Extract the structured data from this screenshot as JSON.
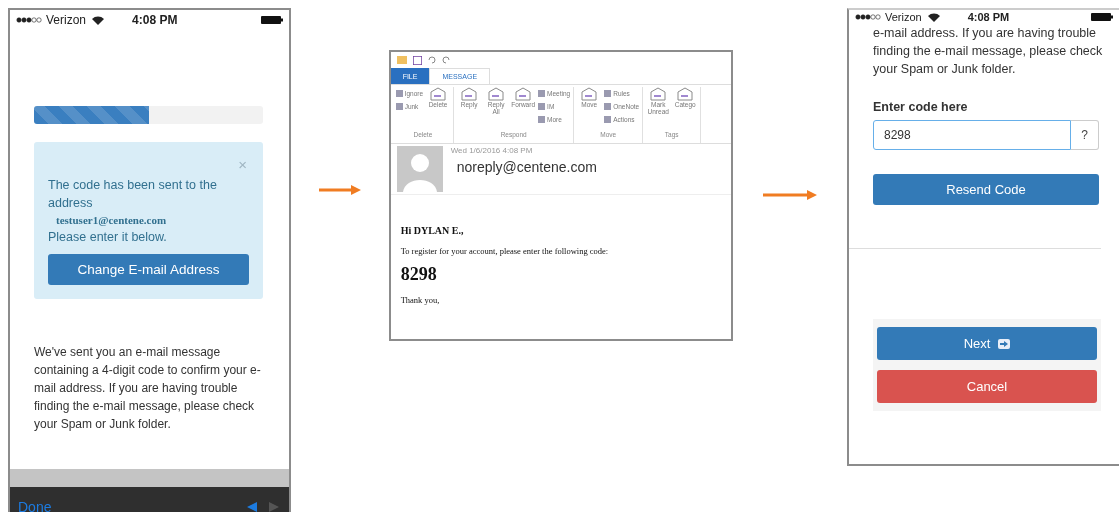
{
  "phone_1": {
    "status_bar": {
      "carrier": "Verizon",
      "time": "4:08 PM"
    },
    "progress": {
      "level": 0.5
    },
    "alert": {
      "close": "×",
      "text": "The code has been sent to the address",
      "email": "testuser1@centene.com",
      "note": "Please enter it below.",
      "button": "Change E-mail Address"
    },
    "message": "We've sent you an e-mail message containing a 4-digit code to confirm your e-mail address. If you are having trouble finding the e-mail message, please check your Spam or Junk folder.",
    "keyboard_bar": {
      "done": "Done"
    }
  },
  "email_window": {
    "tabs": [
      {
        "label": "FILE",
        "selected": false
      },
      {
        "label": "MESSAGE",
        "selected": true
      }
    ],
    "ribbon_groups": [
      {
        "label": "Delete",
        "items": [
          {
            "label": "Ignore",
            "kind": "small"
          },
          {
            "label": "Junk",
            "kind": "small"
          },
          {
            "label": "Delete",
            "kind": "large"
          }
        ]
      },
      {
        "label": "Respond",
        "items": [
          {
            "label": "Reply",
            "kind": "large"
          },
          {
            "label": "Reply All",
            "kind": "large"
          },
          {
            "label": "Forward",
            "kind": "large"
          },
          {
            "label": "Meeting",
            "kind": "small"
          },
          {
            "label": "IM",
            "kind": "small"
          },
          {
            "label": "More",
            "kind": "small"
          }
        ]
      },
      {
        "label": "Move",
        "items": [
          {
            "label": "Move",
            "kind": "large"
          },
          {
            "label": "Rules",
            "kind": "small"
          },
          {
            "label": "OneNote",
            "kind": "small"
          },
          {
            "label": "Actions",
            "kind": "small"
          }
        ]
      },
      {
        "label": "Tags",
        "items": [
          {
            "label": "Mark Unread",
            "kind": "large"
          },
          {
            "label": "Catego",
            "kind": "large"
          }
        ]
      }
    ],
    "date": "Wed 1/6/2016 4:08 PM",
    "sender": "noreply@centene.com",
    "body": {
      "greeting": "Hi DYLAN E.,",
      "text": "To register for your account, please enter the following code:",
      "code": "8298",
      "closing": "Thank you,"
    }
  },
  "phone_2": {
    "status_bar": {
      "carrier": "Verizon",
      "time": "4:08 PM"
    },
    "message": "e-mail address. If you are having trouble finding the e-mail message, please check your Spam or Junk folder.",
    "code_label": "Enter code here",
    "code_value": "8298",
    "help": "?",
    "resend": "Resend Code",
    "next": "Next",
    "cancel": "Cancel"
  }
}
